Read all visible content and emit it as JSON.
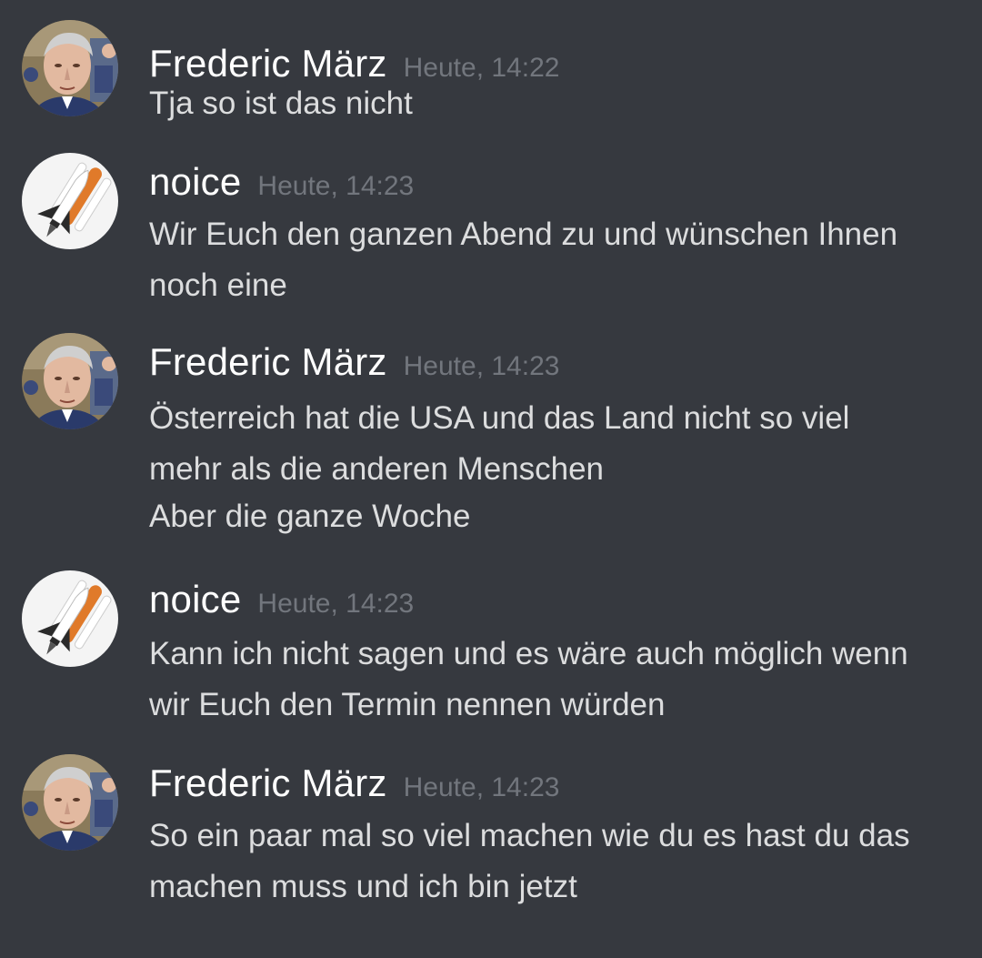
{
  "messages": [
    {
      "author": "Frederic März",
      "avatar": "man-portrait-avatar",
      "timestamp": "Heute, 14:22",
      "lines": [
        "Tja so ist das nicht"
      ]
    },
    {
      "author": "noice",
      "avatar": "space-shuttle-avatar",
      "timestamp": "Heute, 14:23",
      "lines": [
        "Wir Euch den ganzen Abend zu und wünschen Ihnen",
        "noch eine"
      ]
    },
    {
      "author": "Frederic März",
      "avatar": "man-portrait-avatar",
      "timestamp": "Heute, 14:23",
      "lines": [
        "Österreich hat die USA und das Land nicht so viel",
        "mehr als die anderen Menschen",
        "Aber die ganze Woche"
      ]
    },
    {
      "author": "noice",
      "avatar": "space-shuttle-avatar",
      "timestamp": "Heute, 14:23",
      "lines": [
        "Kann ich nicht sagen und es wäre auch möglich wenn",
        "wir Euch den Termin nennen würden"
      ]
    },
    {
      "author": "Frederic März",
      "avatar": "man-portrait-avatar",
      "timestamp": "Heute, 14:23",
      "lines": [
        "So ein paar mal so viel machen wie du es hast du das",
        "machen muss und ich bin jetzt"
      ]
    }
  ],
  "colors": {
    "background": "#36393f",
    "username": "#ffffff",
    "timestamp": "#72767d",
    "text": "#dcddde"
  }
}
